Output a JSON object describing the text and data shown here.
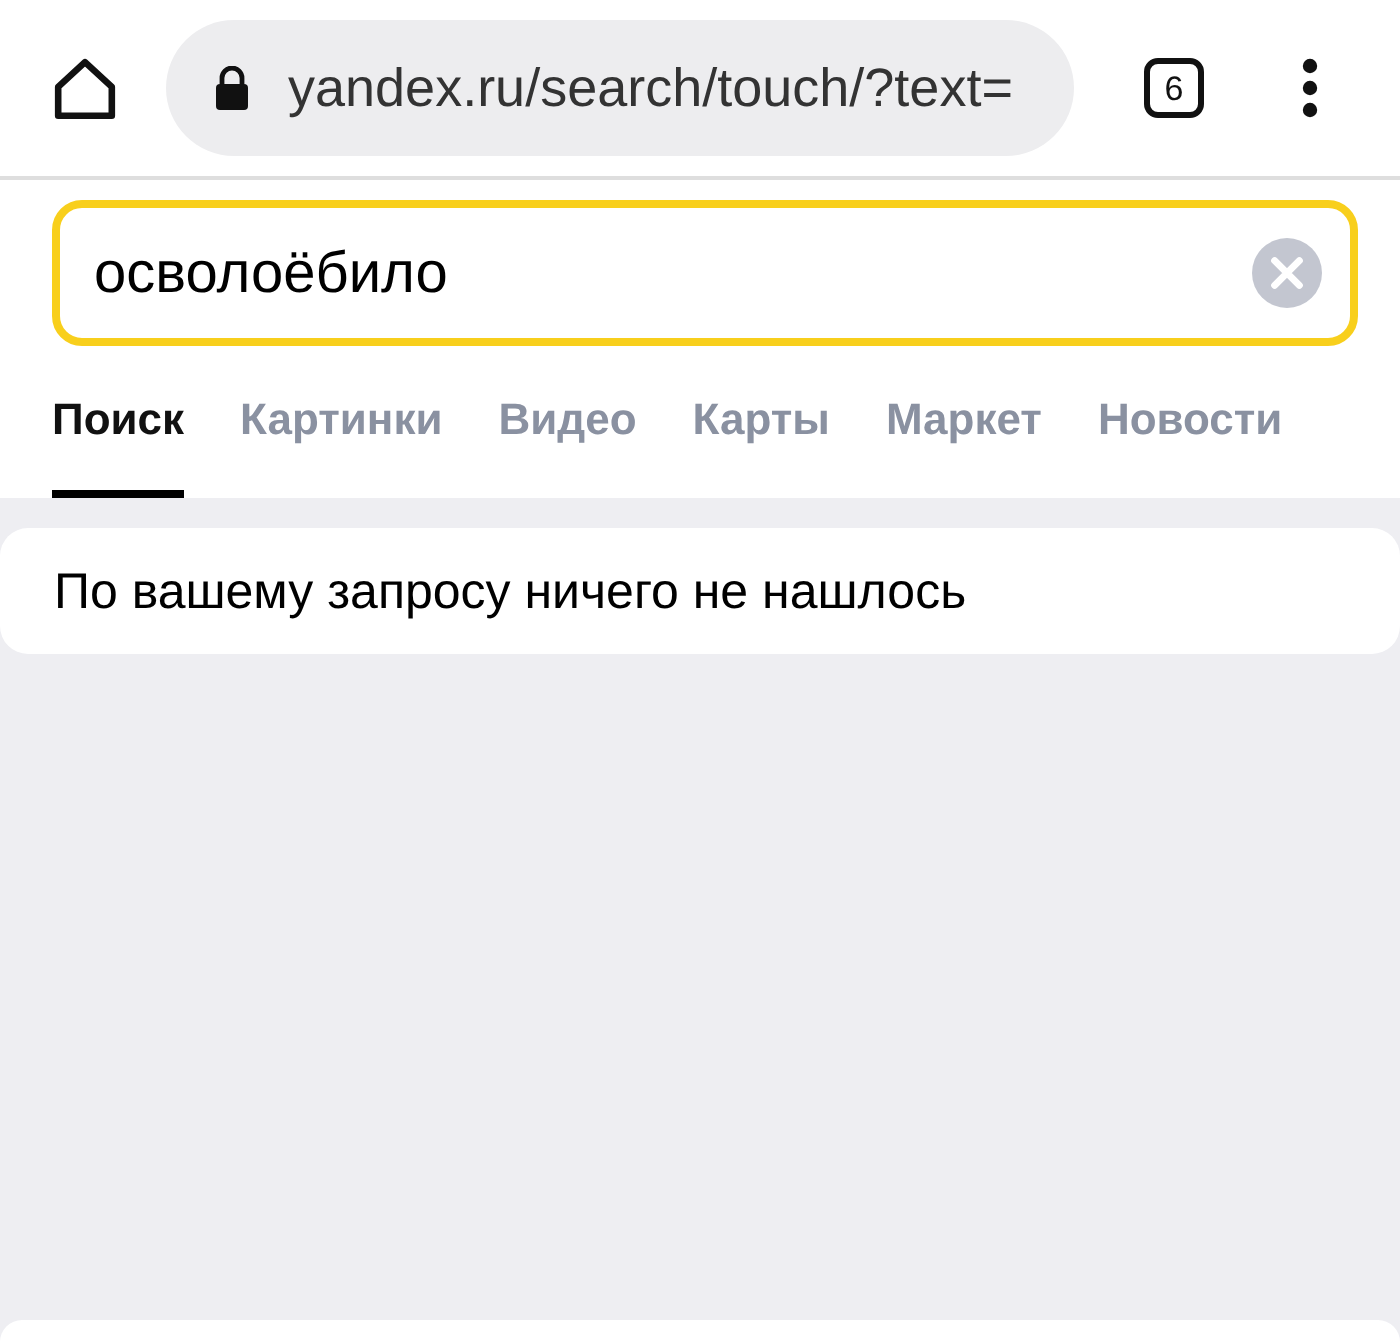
{
  "browser_bar": {
    "url": "yandex.ru/search/touch/?text=",
    "tab_count": "6"
  },
  "search": {
    "value": "осволоёбило"
  },
  "tabs": [
    {
      "label": "Поиск",
      "selected": true
    },
    {
      "label": "Картинки",
      "selected": false
    },
    {
      "label": "Видео",
      "selected": false
    },
    {
      "label": "Карты",
      "selected": false
    },
    {
      "label": "Маркет",
      "selected": false
    },
    {
      "label": "Новости",
      "selected": false
    }
  ],
  "results": {
    "message": "По вашему запросу ничего не нашлось"
  }
}
